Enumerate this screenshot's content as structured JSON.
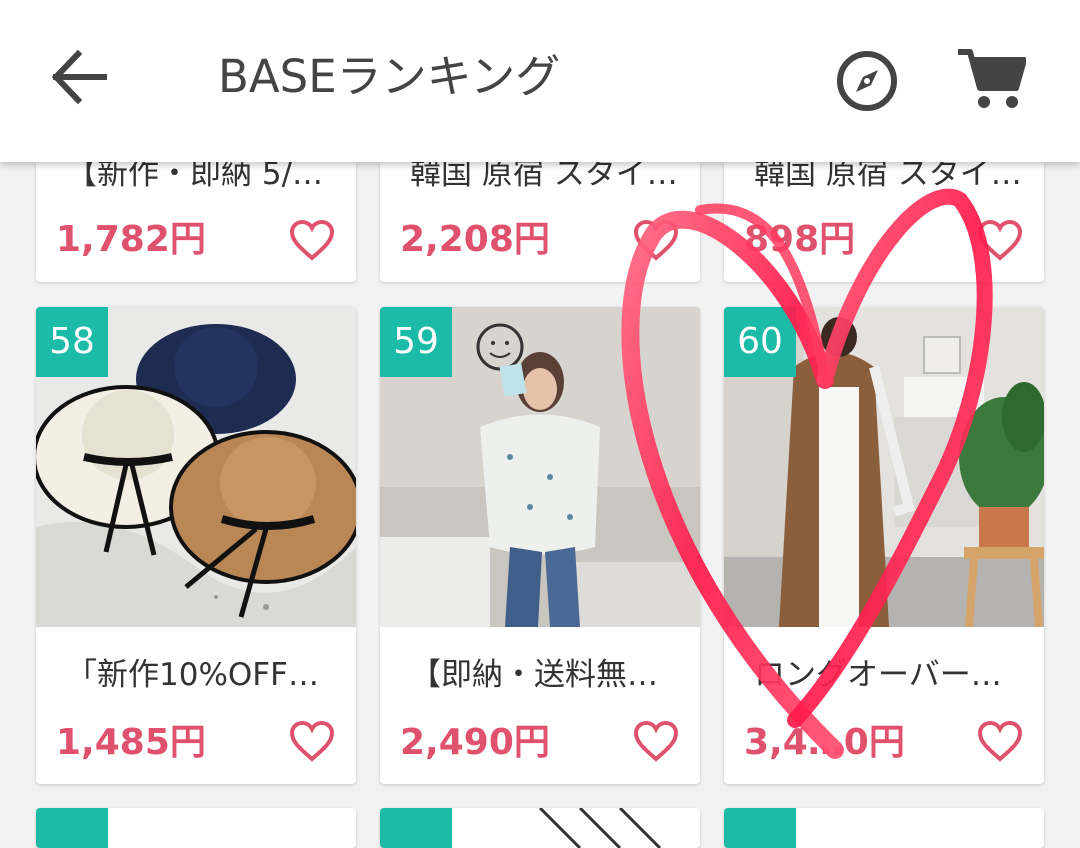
{
  "header": {
    "title": "BASEランキング",
    "back_icon": "arrow-left-icon",
    "compass_icon": "compass-icon",
    "cart_icon": "cart-icon"
  },
  "products_top": [
    {
      "name": "【新作・即納 5/…",
      "price": "1,782円"
    },
    {
      "name": "韓国 原宿 スタイ…",
      "price": "2,208円"
    },
    {
      "name": "韓国 原宿 スタイ…",
      "price": "898円"
    }
  ],
  "products_mid": [
    {
      "rank": "58",
      "name": "「新作10%OFF…",
      "price": "1,485円"
    },
    {
      "rank": "59",
      "name": "【即納・送料無…",
      "price": "2,490円"
    },
    {
      "rank": "60",
      "name": "ロングオーバー…",
      "price": "3,4…0円"
    }
  ],
  "colors": {
    "accent_teal": "#1bbba8",
    "price_pink": "#e0516e",
    "heart_overlay": "#ff2a55"
  }
}
